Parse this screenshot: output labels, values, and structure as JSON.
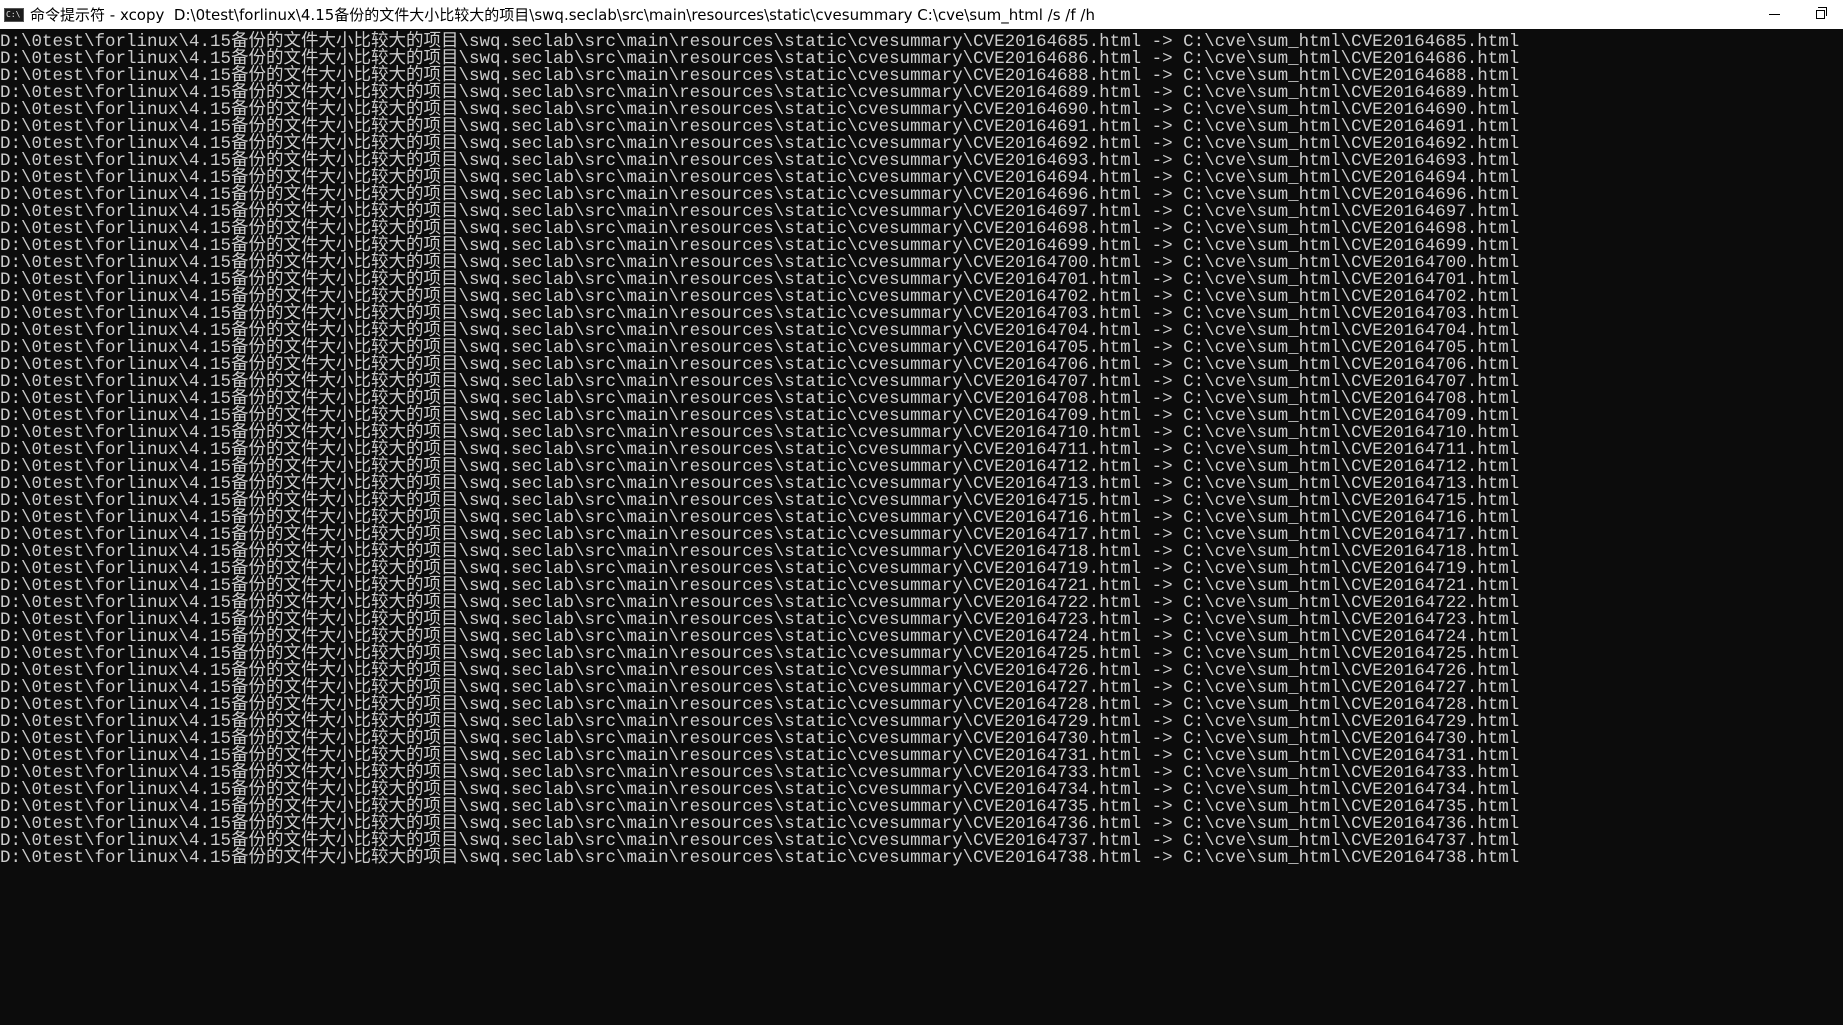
{
  "window": {
    "title": "命令提示符 - xcopy  D:\\0test\\forlinux\\4.15备份的文件大小比较大的项目\\swq.seclab\\src\\main\\resources\\static\\cvesummary C:\\cve\\sum_html /s /f /h",
    "icon_name": "cmd-icon",
    "icon_text": "C:\\",
    "controls": [
      "minimize-icon",
      "restore-icon"
    ]
  },
  "console": {
    "text_color": "#cccccc",
    "background": "#0c0c0c",
    "lines": [
      "D:\\0test\\forlinux\\4.15备份的文件大小比较大的项目\\swq.seclab\\src\\main\\resources\\static\\cvesummary\\CVE20164685.html -> C:\\cve\\sum_html\\CVE20164685.html",
      "D:\\0test\\forlinux\\4.15备份的文件大小比较大的项目\\swq.seclab\\src\\main\\resources\\static\\cvesummary\\CVE20164686.html -> C:\\cve\\sum_html\\CVE20164686.html",
      "D:\\0test\\forlinux\\4.15备份的文件大小比较大的项目\\swq.seclab\\src\\main\\resources\\static\\cvesummary\\CVE20164688.html -> C:\\cve\\sum_html\\CVE20164688.html",
      "D:\\0test\\forlinux\\4.15备份的文件大小比较大的项目\\swq.seclab\\src\\main\\resources\\static\\cvesummary\\CVE20164689.html -> C:\\cve\\sum_html\\CVE20164689.html",
      "D:\\0test\\forlinux\\4.15备份的文件大小比较大的项目\\swq.seclab\\src\\main\\resources\\static\\cvesummary\\CVE20164690.html -> C:\\cve\\sum_html\\CVE20164690.html",
      "D:\\0test\\forlinux\\4.15备份的文件大小比较大的项目\\swq.seclab\\src\\main\\resources\\static\\cvesummary\\CVE20164691.html -> C:\\cve\\sum_html\\CVE20164691.html",
      "D:\\0test\\forlinux\\4.15备份的文件大小比较大的项目\\swq.seclab\\src\\main\\resources\\static\\cvesummary\\CVE20164692.html -> C:\\cve\\sum_html\\CVE20164692.html",
      "D:\\0test\\forlinux\\4.15备份的文件大小比较大的项目\\swq.seclab\\src\\main\\resources\\static\\cvesummary\\CVE20164693.html -> C:\\cve\\sum_html\\CVE20164693.html",
      "D:\\0test\\forlinux\\4.15备份的文件大小比较大的项目\\swq.seclab\\src\\main\\resources\\static\\cvesummary\\CVE20164694.html -> C:\\cve\\sum_html\\CVE20164694.html",
      "D:\\0test\\forlinux\\4.15备份的文件大小比较大的项目\\swq.seclab\\src\\main\\resources\\static\\cvesummary\\CVE20164696.html -> C:\\cve\\sum_html\\CVE20164696.html",
      "D:\\0test\\forlinux\\4.15备份的文件大小比较大的项目\\swq.seclab\\src\\main\\resources\\static\\cvesummary\\CVE20164697.html -> C:\\cve\\sum_html\\CVE20164697.html",
      "D:\\0test\\forlinux\\4.15备份的文件大小比较大的项目\\swq.seclab\\src\\main\\resources\\static\\cvesummary\\CVE20164698.html -> C:\\cve\\sum_html\\CVE20164698.html",
      "D:\\0test\\forlinux\\4.15备份的文件大小比较大的项目\\swq.seclab\\src\\main\\resources\\static\\cvesummary\\CVE20164699.html -> C:\\cve\\sum_html\\CVE20164699.html",
      "D:\\0test\\forlinux\\4.15备份的文件大小比较大的项目\\swq.seclab\\src\\main\\resources\\static\\cvesummary\\CVE20164700.html -> C:\\cve\\sum_html\\CVE20164700.html",
      "D:\\0test\\forlinux\\4.15备份的文件大小比较大的项目\\swq.seclab\\src\\main\\resources\\static\\cvesummary\\CVE20164701.html -> C:\\cve\\sum_html\\CVE20164701.html",
      "D:\\0test\\forlinux\\4.15备份的文件大小比较大的项目\\swq.seclab\\src\\main\\resources\\static\\cvesummary\\CVE20164702.html -> C:\\cve\\sum_html\\CVE20164702.html",
      "D:\\0test\\forlinux\\4.15备份的文件大小比较大的项目\\swq.seclab\\src\\main\\resources\\static\\cvesummary\\CVE20164703.html -> C:\\cve\\sum_html\\CVE20164703.html",
      "D:\\0test\\forlinux\\4.15备份的文件大小比较大的项目\\swq.seclab\\src\\main\\resources\\static\\cvesummary\\CVE20164704.html -> C:\\cve\\sum_html\\CVE20164704.html",
      "D:\\0test\\forlinux\\4.15备份的文件大小比较大的项目\\swq.seclab\\src\\main\\resources\\static\\cvesummary\\CVE20164705.html -> C:\\cve\\sum_html\\CVE20164705.html",
      "D:\\0test\\forlinux\\4.15备份的文件大小比较大的项目\\swq.seclab\\src\\main\\resources\\static\\cvesummary\\CVE20164706.html -> C:\\cve\\sum_html\\CVE20164706.html",
      "D:\\0test\\forlinux\\4.15备份的文件大小比较大的项目\\swq.seclab\\src\\main\\resources\\static\\cvesummary\\CVE20164707.html -> C:\\cve\\sum_html\\CVE20164707.html",
      "D:\\0test\\forlinux\\4.15备份的文件大小比较大的项目\\swq.seclab\\src\\main\\resources\\static\\cvesummary\\CVE20164708.html -> C:\\cve\\sum_html\\CVE20164708.html",
      "D:\\0test\\forlinux\\4.15备份的文件大小比较大的项目\\swq.seclab\\src\\main\\resources\\static\\cvesummary\\CVE20164709.html -> C:\\cve\\sum_html\\CVE20164709.html",
      "D:\\0test\\forlinux\\4.15备份的文件大小比较大的项目\\swq.seclab\\src\\main\\resources\\static\\cvesummary\\CVE20164710.html -> C:\\cve\\sum_html\\CVE20164710.html",
      "D:\\0test\\forlinux\\4.15备份的文件大小比较大的项目\\swq.seclab\\src\\main\\resources\\static\\cvesummary\\CVE20164711.html -> C:\\cve\\sum_html\\CVE20164711.html",
      "D:\\0test\\forlinux\\4.15备份的文件大小比较大的项目\\swq.seclab\\src\\main\\resources\\static\\cvesummary\\CVE20164712.html -> C:\\cve\\sum_html\\CVE20164712.html",
      "D:\\0test\\forlinux\\4.15备份的文件大小比较大的项目\\swq.seclab\\src\\main\\resources\\static\\cvesummary\\CVE20164713.html -> C:\\cve\\sum_html\\CVE20164713.html",
      "D:\\0test\\forlinux\\4.15备份的文件大小比较大的项目\\swq.seclab\\src\\main\\resources\\static\\cvesummary\\CVE20164715.html -> C:\\cve\\sum_html\\CVE20164715.html",
      "D:\\0test\\forlinux\\4.15备份的文件大小比较大的项目\\swq.seclab\\src\\main\\resources\\static\\cvesummary\\CVE20164716.html -> C:\\cve\\sum_html\\CVE20164716.html",
      "D:\\0test\\forlinux\\4.15备份的文件大小比较大的项目\\swq.seclab\\src\\main\\resources\\static\\cvesummary\\CVE20164717.html -> C:\\cve\\sum_html\\CVE20164717.html",
      "D:\\0test\\forlinux\\4.15备份的文件大小比较大的项目\\swq.seclab\\src\\main\\resources\\static\\cvesummary\\CVE20164718.html -> C:\\cve\\sum_html\\CVE20164718.html",
      "D:\\0test\\forlinux\\4.15备份的文件大小比较大的项目\\swq.seclab\\src\\main\\resources\\static\\cvesummary\\CVE20164719.html -> C:\\cve\\sum_html\\CVE20164719.html",
      "D:\\0test\\forlinux\\4.15备份的文件大小比较大的项目\\swq.seclab\\src\\main\\resources\\static\\cvesummary\\CVE20164721.html -> C:\\cve\\sum_html\\CVE20164721.html",
      "D:\\0test\\forlinux\\4.15备份的文件大小比较大的项目\\swq.seclab\\src\\main\\resources\\static\\cvesummary\\CVE20164722.html -> C:\\cve\\sum_html\\CVE20164722.html",
      "D:\\0test\\forlinux\\4.15备份的文件大小比较大的项目\\swq.seclab\\src\\main\\resources\\static\\cvesummary\\CVE20164723.html -> C:\\cve\\sum_html\\CVE20164723.html",
      "D:\\0test\\forlinux\\4.15备份的文件大小比较大的项目\\swq.seclab\\src\\main\\resources\\static\\cvesummary\\CVE20164724.html -> C:\\cve\\sum_html\\CVE20164724.html",
      "D:\\0test\\forlinux\\4.15备份的文件大小比较大的项目\\swq.seclab\\src\\main\\resources\\static\\cvesummary\\CVE20164725.html -> C:\\cve\\sum_html\\CVE20164725.html",
      "D:\\0test\\forlinux\\4.15备份的文件大小比较大的项目\\swq.seclab\\src\\main\\resources\\static\\cvesummary\\CVE20164726.html -> C:\\cve\\sum_html\\CVE20164726.html",
      "D:\\0test\\forlinux\\4.15备份的文件大小比较大的项目\\swq.seclab\\src\\main\\resources\\static\\cvesummary\\CVE20164727.html -> C:\\cve\\sum_html\\CVE20164727.html",
      "D:\\0test\\forlinux\\4.15备份的文件大小比较大的项目\\swq.seclab\\src\\main\\resources\\static\\cvesummary\\CVE20164728.html -> C:\\cve\\sum_html\\CVE20164728.html",
      "D:\\0test\\forlinux\\4.15备份的文件大小比较大的项目\\swq.seclab\\src\\main\\resources\\static\\cvesummary\\CVE20164729.html -> C:\\cve\\sum_html\\CVE20164729.html",
      "D:\\0test\\forlinux\\4.15备份的文件大小比较大的项目\\swq.seclab\\src\\main\\resources\\static\\cvesummary\\CVE20164730.html -> C:\\cve\\sum_html\\CVE20164730.html",
      "D:\\0test\\forlinux\\4.15备份的文件大小比较大的项目\\swq.seclab\\src\\main\\resources\\static\\cvesummary\\CVE20164731.html -> C:\\cve\\sum_html\\CVE20164731.html",
      "D:\\0test\\forlinux\\4.15备份的文件大小比较大的项目\\swq.seclab\\src\\main\\resources\\static\\cvesummary\\CVE20164733.html -> C:\\cve\\sum_html\\CVE20164733.html",
      "D:\\0test\\forlinux\\4.15备份的文件大小比较大的项目\\swq.seclab\\src\\main\\resources\\static\\cvesummary\\CVE20164734.html -> C:\\cve\\sum_html\\CVE20164734.html",
      "D:\\0test\\forlinux\\4.15备份的文件大小比较大的项目\\swq.seclab\\src\\main\\resources\\static\\cvesummary\\CVE20164735.html -> C:\\cve\\sum_html\\CVE20164735.html",
      "D:\\0test\\forlinux\\4.15备份的文件大小比较大的项目\\swq.seclab\\src\\main\\resources\\static\\cvesummary\\CVE20164736.html -> C:\\cve\\sum_html\\CVE20164736.html",
      "D:\\0test\\forlinux\\4.15备份的文件大小比较大的项目\\swq.seclab\\src\\main\\resources\\static\\cvesummary\\CVE20164737.html -> C:\\cve\\sum_html\\CVE20164737.html",
      "D:\\0test\\forlinux\\4.15备份的文件大小比较大的项目\\swq.seclab\\src\\main\\resources\\static\\cvesummary\\CVE20164738.html -> C:\\cve\\sum_html\\CVE20164738.html"
    ]
  }
}
